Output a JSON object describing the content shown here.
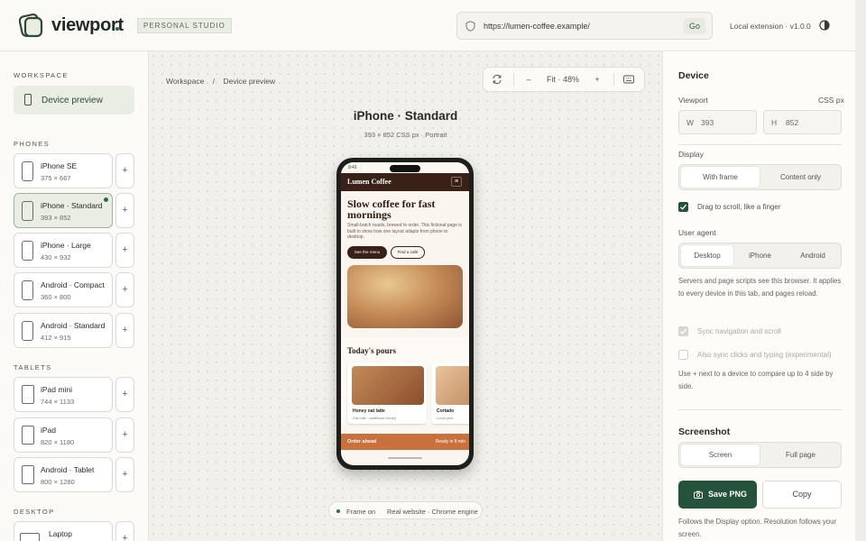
{
  "header": {
    "brand": "viewport",
    "studio_badge": "PERSONAL STUDIO",
    "url": "https://lumen-coffee.example/",
    "go_label": "Go",
    "extension_label": "Local extension · v1.0.0"
  },
  "sidebar": {
    "workspace_heading": "WORKSPACE",
    "device_preview": "Device preview",
    "phones_heading": "PHONES",
    "tablets_heading": "TABLETS",
    "desktop_heading": "DESKTOP",
    "plus": "+",
    "phones": [
      {
        "name": "iPhone SE",
        "size": "375 × 667"
      },
      {
        "name": "iPhone · Standard",
        "size": "393 × 852"
      },
      {
        "name": "iPhone · Large",
        "size": "430 × 932"
      },
      {
        "name": "Android · Compact",
        "size": "360 × 800"
      },
      {
        "name": "Android · Standard",
        "size": "412 × 915"
      }
    ],
    "tablets": [
      {
        "name": "iPad mini",
        "size": "744 × 1133"
      },
      {
        "name": "iPad",
        "size": "820 × 1180"
      },
      {
        "name": "Android · Tablet",
        "size": "800 × 1280"
      }
    ],
    "desktop": [
      {
        "name": "Laptop",
        "size": ""
      }
    ]
  },
  "canvas": {
    "breadcrumb_root": "Workspace",
    "breadcrumb_sep": "/",
    "breadcrumb_current": "Device preview",
    "zoom_minus": "–",
    "zoom_label": "Fit · 48%",
    "zoom_plus": "+",
    "device_title": "iPhone · Standard",
    "device_subtitle": "393 × 852 CSS px · Portrait",
    "status_frame": "Frame on",
    "status_engine": "Real website · Chrome engine"
  },
  "preview": {
    "time": "9:41",
    "site_name": "Lumen Coffee",
    "menu_glyph": "≡",
    "hero_title": "Slow coffee for fast mornings",
    "hero_body": "Small-batch roasts, brewed to order. This fictional page is built to show how one layout adapts from phone to desktop.",
    "btn_primary": "See the menu",
    "btn_secondary": "Find a café",
    "section_title": "Today's pours",
    "cards": [
      {
        "title": "Honey oat latte",
        "sub": "Oat milk · wildflower honey"
      },
      {
        "title": "Cortado",
        "sub": "Local perk"
      }
    ],
    "order_label": "Order ahead",
    "order_right": "Ready in 8 min"
  },
  "panel": {
    "device_heading": "Device",
    "viewport_label": "Viewport",
    "units_label": "CSS px",
    "width_prefix": "W",
    "width_value": "393",
    "height_prefix": "H",
    "height_value": "852",
    "display_label": "Display",
    "display_options": [
      "With frame",
      "Content only"
    ],
    "drag_scroll_label": "Drag to scroll, like a finger",
    "user_agent_label": "User agent",
    "ua_options": [
      "Desktop",
      "iPhone",
      "Android"
    ],
    "ua_note": "Servers and page scripts see this browser. It applies to every device in this tab, and pages reload.",
    "sync_nav_label": "Sync navigation and scroll",
    "sync_clicks_label": "Also sync clicks and typing (experimental)",
    "compare_note": "Use + next to a device to compare up to 4 side by side.",
    "screenshot_heading": "Screenshot",
    "screenshot_options": [
      "Screen",
      "Full page"
    ],
    "save_label": "Save PNG",
    "copy_label": "Copy",
    "footer_note": "Follows the Display option. Resolution follows your screen."
  },
  "colors": {
    "accent": "#24523a",
    "brand_dot": "#2f6b48",
    "coffee_dark": "#3a2118",
    "order_bar": "#c9713d"
  }
}
